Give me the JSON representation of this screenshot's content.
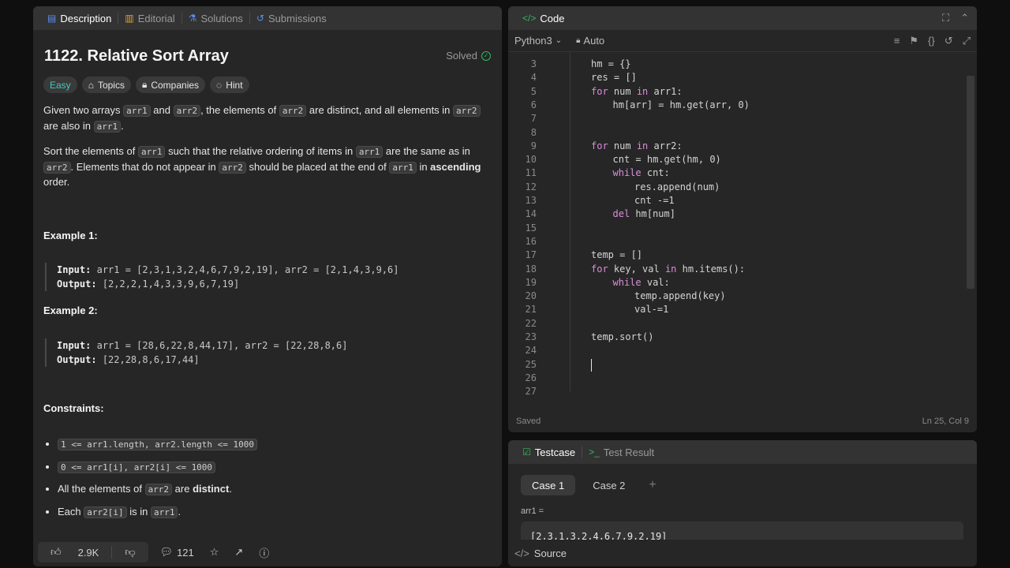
{
  "left_tabs": [
    {
      "label": "Description",
      "icon": "document-icon"
    },
    {
      "label": "Editorial",
      "icon": "book-icon"
    },
    {
      "label": "Solutions",
      "icon": "flask-icon"
    },
    {
      "label": "Submissions",
      "icon": "history-icon"
    }
  ],
  "problem": {
    "title": "1122. Relative Sort Array",
    "status": "Solved",
    "tags": [
      "Easy",
      "Topics",
      "Companies",
      "Hint"
    ]
  },
  "description": {
    "p1_a": "Given two arrays ",
    "p1_arr1": "arr1",
    "p1_b": " and ",
    "p1_arr2": "arr2",
    "p1_c": ", the elements of ",
    "p1_arr2b": "arr2",
    "p1_d": " are distinct, and all elements in ",
    "p1_arr2c": "arr2",
    "p1_e": " are also in ",
    "p1_arr1b": "arr1",
    "p1_f": ".",
    "p2_a": "Sort the elements of ",
    "p2_arr1": "arr1",
    "p2_b": " such that the relative ordering of items in ",
    "p2_arr1b": "arr1",
    "p2_c": " are the same as in ",
    "p2_arr2": "arr2",
    "p2_d": ". Elements that do not appear in ",
    "p2_arr2b": "arr2",
    "p2_e": " should be placed at the end of ",
    "p2_arr1c": "arr1",
    "p2_f": " in ",
    "p2_bold": "ascending",
    "p2_g": " order."
  },
  "examples": [
    {
      "heading": "Example 1:",
      "input_label": "Input:",
      "input": "arr1 = [2,3,1,3,2,4,6,7,9,2,19], arr2 = [2,1,4,3,9,6]",
      "output_label": "Output:",
      "output": "[2,2,2,1,4,3,3,9,6,7,19]"
    },
    {
      "heading": "Example 2:",
      "input_label": "Input:",
      "input": "arr1 = [28,6,22,8,44,17], arr2 = [22,28,8,6]",
      "output_label": "Output:",
      "output": "[22,28,8,6,17,44]"
    }
  ],
  "constraints": {
    "heading": "Constraints:",
    "c1": "1 <= arr1.length, arr2.length <= 1000",
    "c2": "0 <= arr1[i], arr2[i] <= 1000",
    "c3_a": "All the elements of ",
    "c3_code": "arr2",
    "c3_b": " are ",
    "c3_bold": "distinct",
    "c3_c": ".",
    "c4_a": "Each ",
    "c4_code": "arr2[i]",
    "c4_b": " is in ",
    "c4_code2": "arr1",
    "c4_c": "."
  },
  "bottom_bar": {
    "likes": "2.9K",
    "comments": "121"
  },
  "editor": {
    "tab_label": "Code",
    "language": "Python3",
    "mode": "Auto",
    "status_left": "Saved",
    "status_right": "Ln 25, Col 9",
    "lines": [
      {
        "n": "3",
        "indent": 0,
        "text": "hm = {}"
      },
      {
        "n": "4",
        "indent": 0,
        "text": "res = []"
      },
      {
        "n": "5",
        "indent": 0,
        "kw": "for",
        "text": " num ",
        "kw2": "in",
        "text2": " arr1:"
      },
      {
        "n": "6",
        "indent": 1,
        "text": "hm[arr] = hm.get(arr, 0)"
      },
      {
        "n": "7",
        "indent": 0,
        "text": ""
      },
      {
        "n": "8",
        "indent": 0,
        "text": ""
      },
      {
        "n": "9",
        "indent": 0,
        "kw": "for",
        "text": " num ",
        "kw2": "in",
        "text2": " arr2:"
      },
      {
        "n": "10",
        "indent": 1,
        "text": "cnt = hm.get(hm, 0)"
      },
      {
        "n": "11",
        "indent": 1,
        "kw": "while",
        "text": " cnt:"
      },
      {
        "n": "12",
        "indent": 2,
        "text": "res.append(num)"
      },
      {
        "n": "13",
        "indent": 2,
        "text": "cnt -=1"
      },
      {
        "n": "14",
        "indent": 1,
        "kw": "del",
        "text": " hm[num]"
      },
      {
        "n": "15",
        "indent": 0,
        "text": ""
      },
      {
        "n": "16",
        "indent": 0,
        "text": ""
      },
      {
        "n": "17",
        "indent": 0,
        "text": "temp = []"
      },
      {
        "n": "18",
        "indent": 0,
        "kw": "for",
        "text": " key, val ",
        "kw2": "in",
        "text2": " hm.items():"
      },
      {
        "n": "19",
        "indent": 1,
        "kw": "while",
        "text": " val:"
      },
      {
        "n": "20",
        "indent": 2,
        "text": "temp.append(key)"
      },
      {
        "n": "21",
        "indent": 2,
        "text": "val-=1"
      },
      {
        "n": "22",
        "indent": 0,
        "text": ""
      },
      {
        "n": "23",
        "indent": 0,
        "text": "temp.sort()"
      },
      {
        "n": "24",
        "indent": 0,
        "text": ""
      },
      {
        "n": "25",
        "indent": 0,
        "text": ""
      },
      {
        "n": "26",
        "indent": 0,
        "text": ""
      },
      {
        "n": "27",
        "indent": 0,
        "text": ""
      }
    ]
  },
  "testcase": {
    "tabs": [
      "Testcase",
      "Test Result"
    ],
    "cases": [
      "Case 1",
      "Case 2"
    ],
    "plus": "+",
    "var_label": "arr1 =",
    "var_value": "[2,3,1,3,2,4,6,7,9,2,19]",
    "source_label": "Source"
  },
  "colors": {
    "accent_green": "#2cbb5d",
    "easy": "#46c6c2",
    "keyword": "#d98fd9"
  }
}
